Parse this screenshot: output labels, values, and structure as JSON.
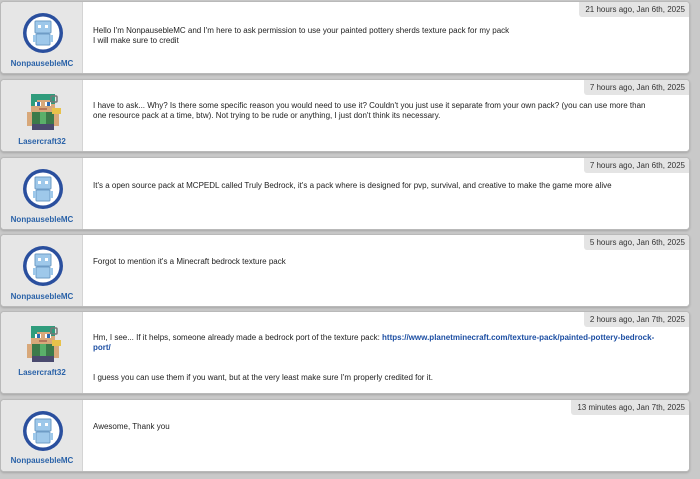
{
  "comments": [
    {
      "author": "NonpauseblеMC",
      "avatar_icon": "robot-avatar-icon",
      "timestamp": "21 hours ago, Jan 6th, 2025",
      "lines": [
        "Hello I'm NonpauseblеMC and I'm here to ask permission to use your painted pottery sherds texture pack for my pack",
        "I will make sure to credit"
      ]
    },
    {
      "author": "Lasercraft32",
      "avatar_icon": "minecraft-character-avatar-icon",
      "timestamp": "7 hours ago, Jan 6th, 2025",
      "lines": [
        "I have to ask... Why? Is there some specific reason you would need to use it? Couldn't you just use it separate from your own pack? (you can use more than one resource pack at a time, btw). Not trying to be rude or anything, I just don't think its necessary."
      ]
    },
    {
      "author": "NonpauseblеMC",
      "avatar_icon": "robot-avatar-icon",
      "timestamp": "7 hours ago, Jan 6th, 2025",
      "lines": [
        "It's a open source pack at MCPEDL called Truly Bedrock, it's a pack where is designed for pvp, survival, and creative to make the game more alive"
      ]
    },
    {
      "author": "NonpauseblеMC",
      "avatar_icon": "robot-avatar-icon",
      "timestamp": "5 hours ago, Jan 6th, 2025",
      "lines": [
        "Forgot to mention it's a Minecraft bedrock texture pack"
      ]
    },
    {
      "author": "Lasercraft32",
      "avatar_icon": "minecraft-character-avatar-icon",
      "timestamp": "2 hours ago, Jan 7th, 2025",
      "text_before_link": "Hm, I see... If it helps, someone already made a bedrock port of the texture pack: ",
      "link": "https://www.planetminecraft.com/texture-pack/painted-pottery-bedrock-port/",
      "after": "I guess you can use them if you want, but at the very least make sure I'm properly credited for it."
    },
    {
      "author": "NonpauseblеMC",
      "avatar_icon": "robot-avatar-icon",
      "timestamp": "13 minutes ago, Jan 7th, 2025",
      "lines": [
        "Awesome, Thank you"
      ]
    }
  ],
  "colors": {
    "username": "#2a62a8",
    "link": "#1d4fa3",
    "robot_avatar_ring": "#2a4f9e",
    "background": "#c9c9c9"
  }
}
